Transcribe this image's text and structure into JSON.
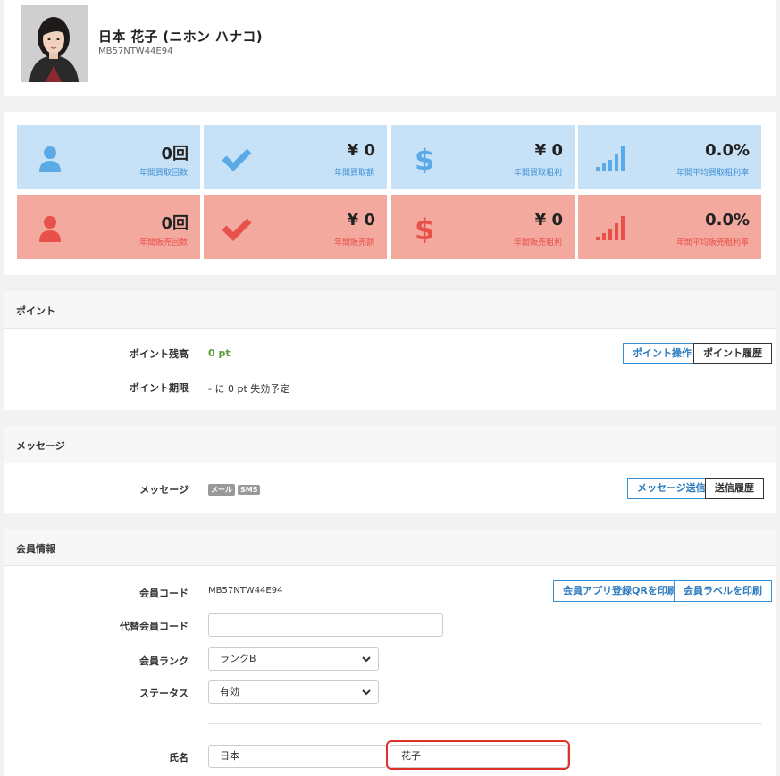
{
  "profile": {
    "name": "日本 花子 (ニホン ハナコ)",
    "code": "MB57NTW44E94"
  },
  "stats": {
    "buy": [
      {
        "value": "0回",
        "label": "年間買取回数",
        "icon": "person-icon"
      },
      {
        "value": "¥ 0",
        "label": "年間買取額",
        "icon": "check-icon"
      },
      {
        "value": "¥ 0",
        "label": "年間買取粗利",
        "icon": "dollar-icon"
      },
      {
        "value": "0.0%",
        "label": "年間平均買取粗利率",
        "icon": "signal-bars-icon"
      }
    ],
    "sell": [
      {
        "value": "0回",
        "label": "年間販売回数",
        "icon": "person-icon"
      },
      {
        "value": "¥ 0",
        "label": "年間販売額",
        "icon": "check-icon"
      },
      {
        "value": "¥ 0",
        "label": "年間販売粗利",
        "icon": "dollar-icon"
      },
      {
        "value": "0.0%",
        "label": "年間平均販売粗利率",
        "icon": "signal-bars-icon"
      }
    ],
    "colors": {
      "buy_bg": "#c7e1f7",
      "buy_accent": "#5aaae8",
      "sell_bg": "#f4a99f",
      "sell_accent": "#e8504a"
    }
  },
  "points": {
    "title": "ポイント",
    "balance_label": "ポイント残高",
    "balance_value": "0 pt",
    "expiry_label": "ポイント期限",
    "expiry_value": "- に 0 pt 失効予定",
    "operate_button": "ポイント操作",
    "history_button": "ポイント履歴"
  },
  "messages": {
    "title": "メッセージ",
    "label": "メッセージ",
    "tags": [
      "メール",
      "SMS"
    ],
    "send_button": "メッセージ送信",
    "history_button": "送信履歴"
  },
  "member": {
    "title": "会員情報",
    "code_label": "会員コード",
    "code_value": "MB57NTW44E94",
    "qr_button": "会員アプリ登録QRを印刷",
    "label_button": "会員ラベルを印刷",
    "alt_code_label": "代替会員コード",
    "alt_code_value": "",
    "rank_label": "会員ランク",
    "rank_value": "ランクB",
    "status_label": "ステータス",
    "status_value": "有効",
    "name_label": "氏名",
    "last_name": "日本",
    "first_name": "花子"
  },
  "highlight_color": "#e0312b"
}
